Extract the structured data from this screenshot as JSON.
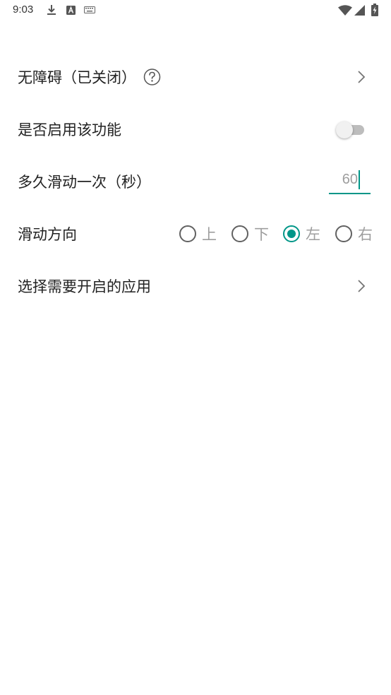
{
  "status_bar": {
    "time": "9:03",
    "icons": [
      "download-icon",
      "a-notification-icon",
      "keyboard-icon",
      "wifi-icon",
      "signal-icon",
      "battery-charging-icon"
    ]
  },
  "settings": {
    "accessibility_label": "无障碍（已关闭）",
    "enable_label": "是否启用该功能",
    "enable_value": false,
    "interval_label": "多久滑动一次（秒）",
    "interval_value": "60",
    "direction_label": "滑动方向",
    "direction_options": [
      "上",
      "下",
      "左",
      "右"
    ],
    "direction_selected": "左",
    "select_apps_label": "选择需要开启的应用"
  },
  "colors": {
    "accent": "#009688",
    "text": "#212121",
    "muted": "#9e9e9e"
  }
}
